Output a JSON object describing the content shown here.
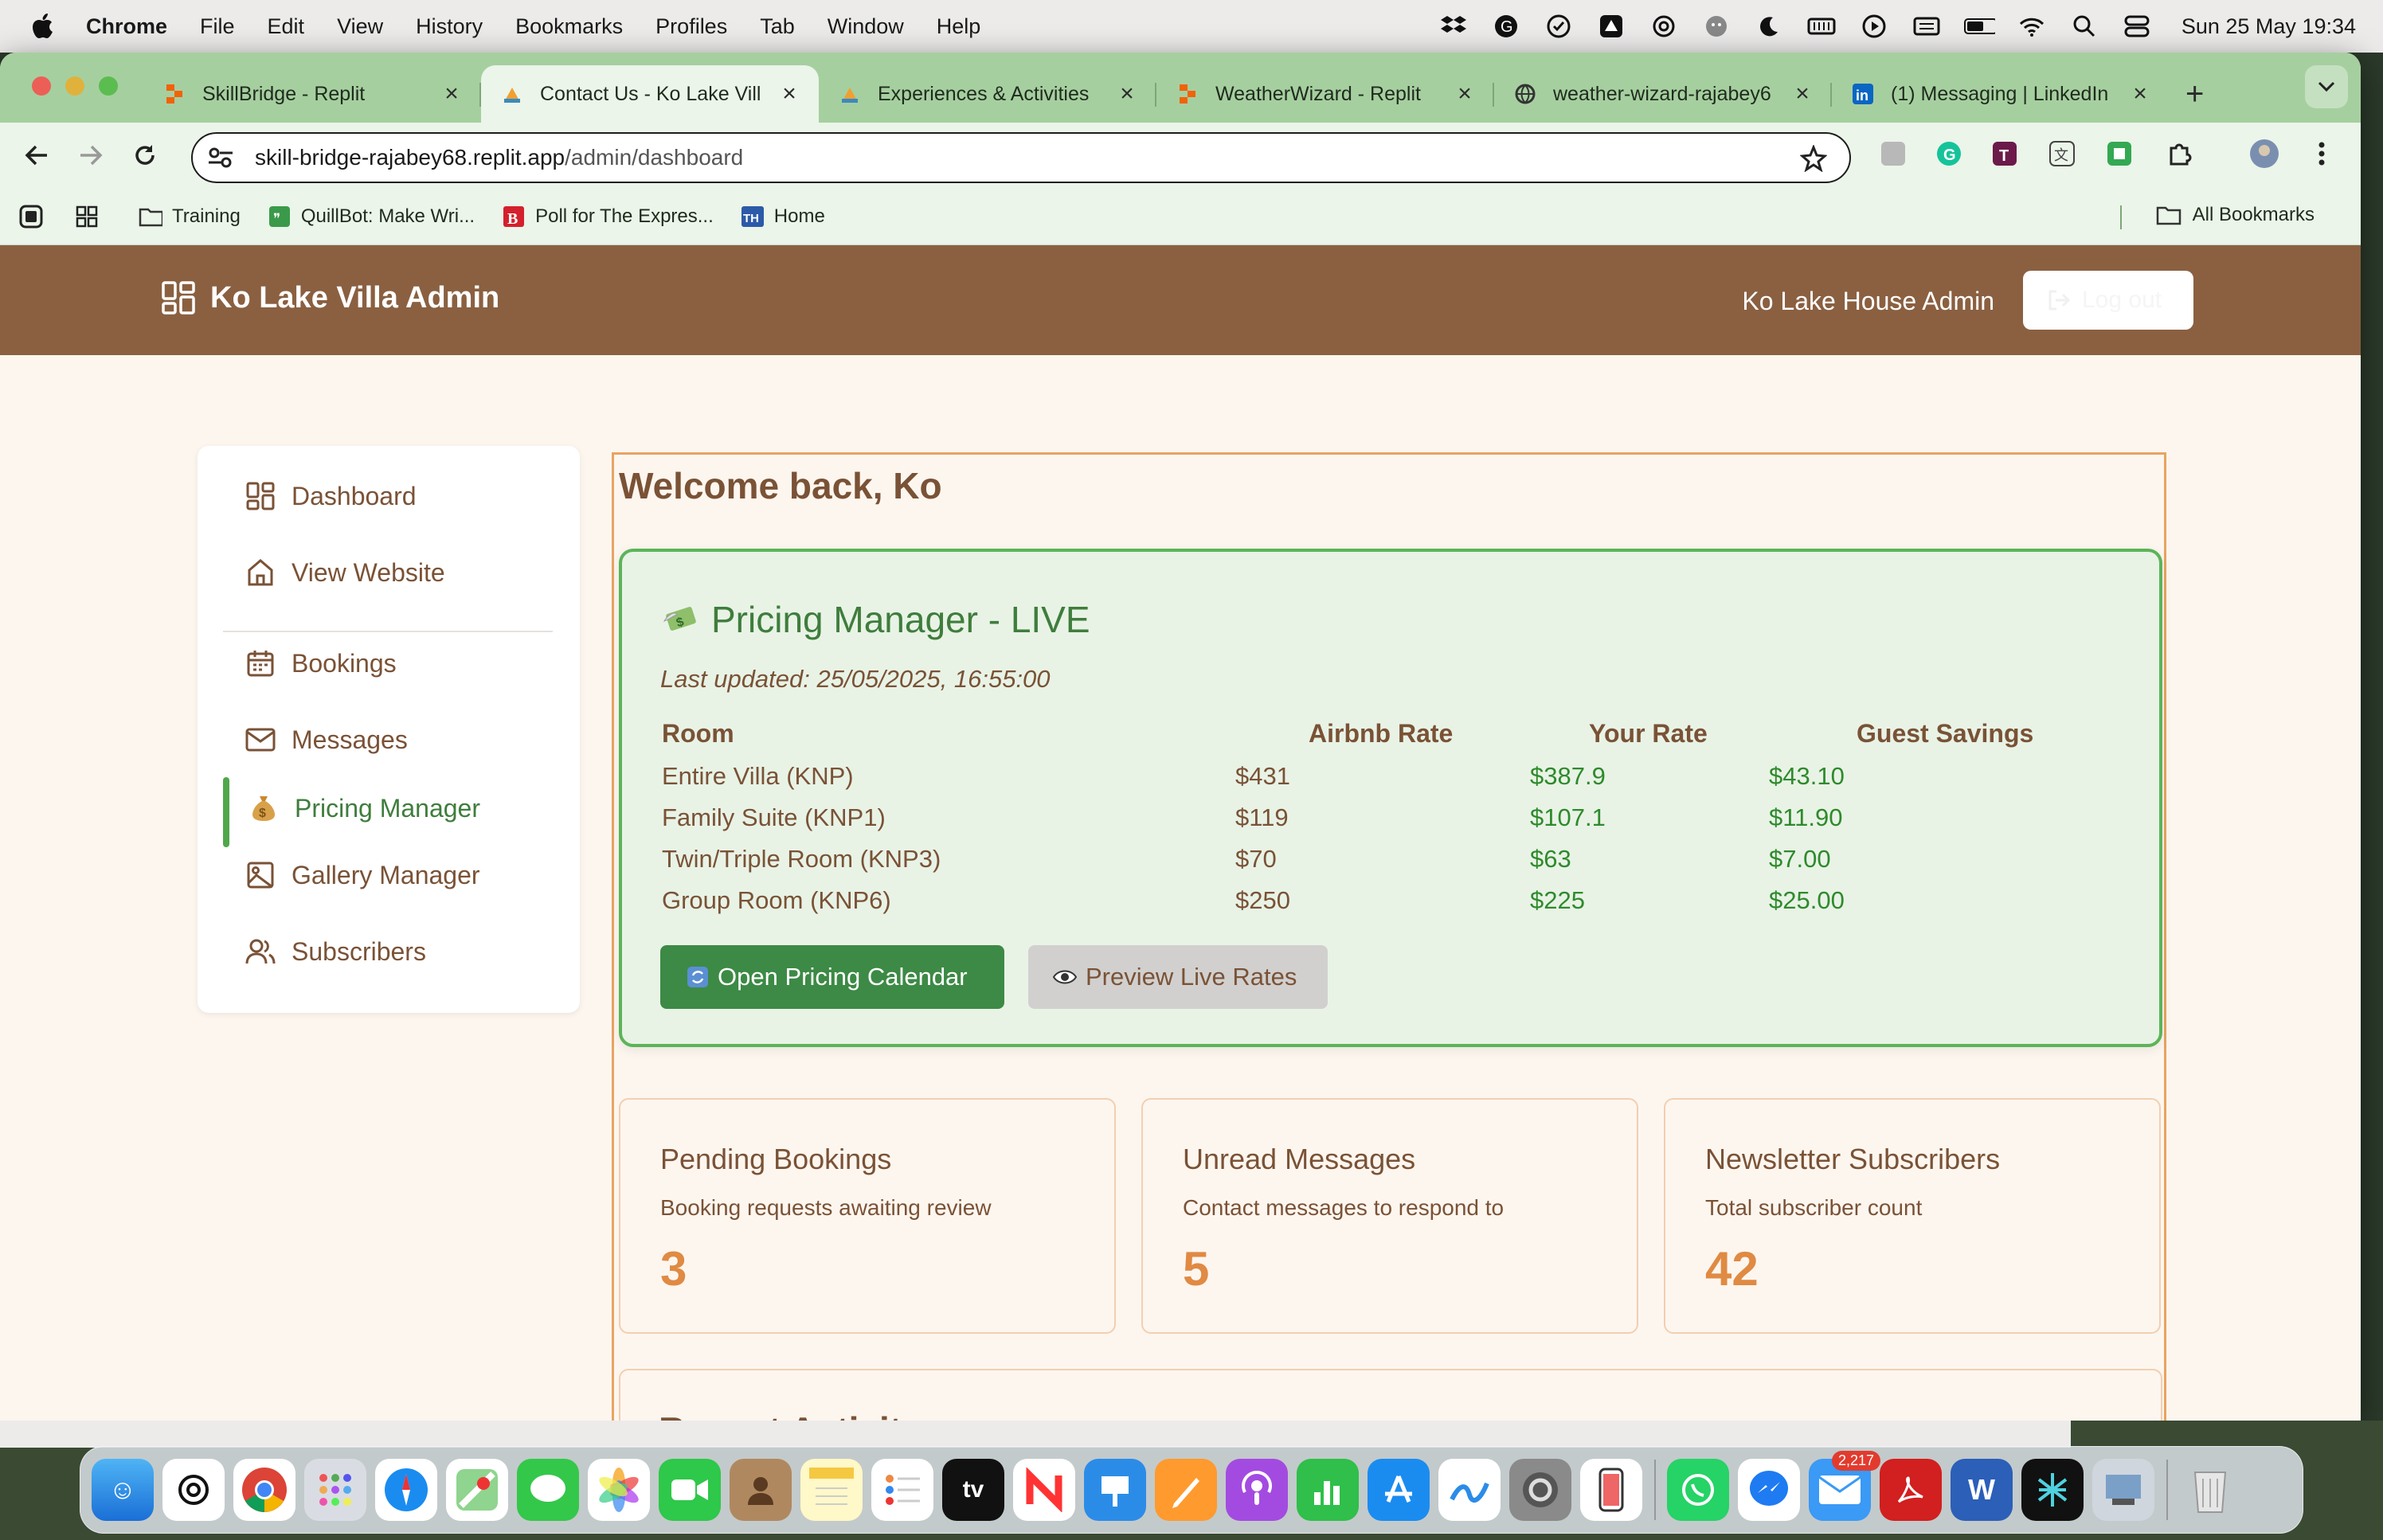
{
  "menubar": {
    "app_name": "Chrome",
    "items": [
      "File",
      "Edit",
      "View",
      "History",
      "Bookmarks",
      "Profiles",
      "Tab",
      "Window",
      "Help"
    ],
    "clock": "Sun 25 May  19:34"
  },
  "browser": {
    "tabs": [
      {
        "title": "SkillBridge - Replit",
        "active": false
      },
      {
        "title": "Contact Us - Ko Lake Vill",
        "active": true
      },
      {
        "title": "Experiences & Activities",
        "active": false
      },
      {
        "title": "WeatherWizard - Replit",
        "active": false
      },
      {
        "title": "weather-wizard-rajabey6",
        "active": false
      },
      {
        "title": "(1) Messaging | LinkedIn",
        "active": false
      }
    ],
    "url_host": "skill-bridge-rajabey68.replit.app",
    "url_path": "/admin/dashboard",
    "bookmarks": [
      "Training",
      "QuillBot: Make Wri...",
      "Poll for The Expres...",
      "Home"
    ],
    "all_bookmarks": "All Bookmarks"
  },
  "header": {
    "brand": "Ko Lake Villa Admin",
    "user": "Ko Lake House Admin",
    "logout": "Log out"
  },
  "sidebar": {
    "items": [
      {
        "label": "Dashboard",
        "icon": "dashboard-grid-icon"
      },
      {
        "label": "View Website",
        "icon": "home-icon"
      },
      {
        "label": "Bookings",
        "icon": "calendar-icon"
      },
      {
        "label": "Messages",
        "icon": "mail-icon"
      },
      {
        "label": "Pricing Manager",
        "icon": "money-bag-icon",
        "active": true
      },
      {
        "label": "Gallery Manager",
        "icon": "image-icon"
      },
      {
        "label": "Subscribers",
        "icon": "users-icon"
      }
    ]
  },
  "main": {
    "welcome": "Welcome back, Ko",
    "pricing": {
      "title": "Pricing Manager - LIVE",
      "updated": "Last updated: 25/05/2025, 16:55:00",
      "headers": [
        "Room",
        "Airbnb Rate",
        "Your Rate",
        "Guest Savings"
      ],
      "rows": [
        [
          "Entire Villa (KNP)",
          "$431",
          "$387.9",
          "$43.10"
        ],
        [
          "Family Suite (KNP1)",
          "$119",
          "$107.1",
          "$11.90"
        ],
        [
          "Twin/Triple Room (KNP3)",
          "$70",
          "$63",
          "$7.00"
        ],
        [
          "Group Room (KNP6)",
          "$250",
          "$225",
          "$25.00"
        ]
      ],
      "btn_calendar": "Open Pricing Calendar",
      "btn_preview": "Preview Live Rates"
    },
    "stats": [
      {
        "title": "Pending Bookings",
        "desc": "Booking requests awaiting review",
        "value": "3"
      },
      {
        "title": "Unread Messages",
        "desc": "Contact messages to respond to",
        "value": "5"
      },
      {
        "title": "Newsletter Subscribers",
        "desc": "Total subscriber count",
        "value": "42"
      }
    ],
    "recent_title": "Recent Activity"
  },
  "dock": {
    "mail_badge": "2,217"
  }
}
